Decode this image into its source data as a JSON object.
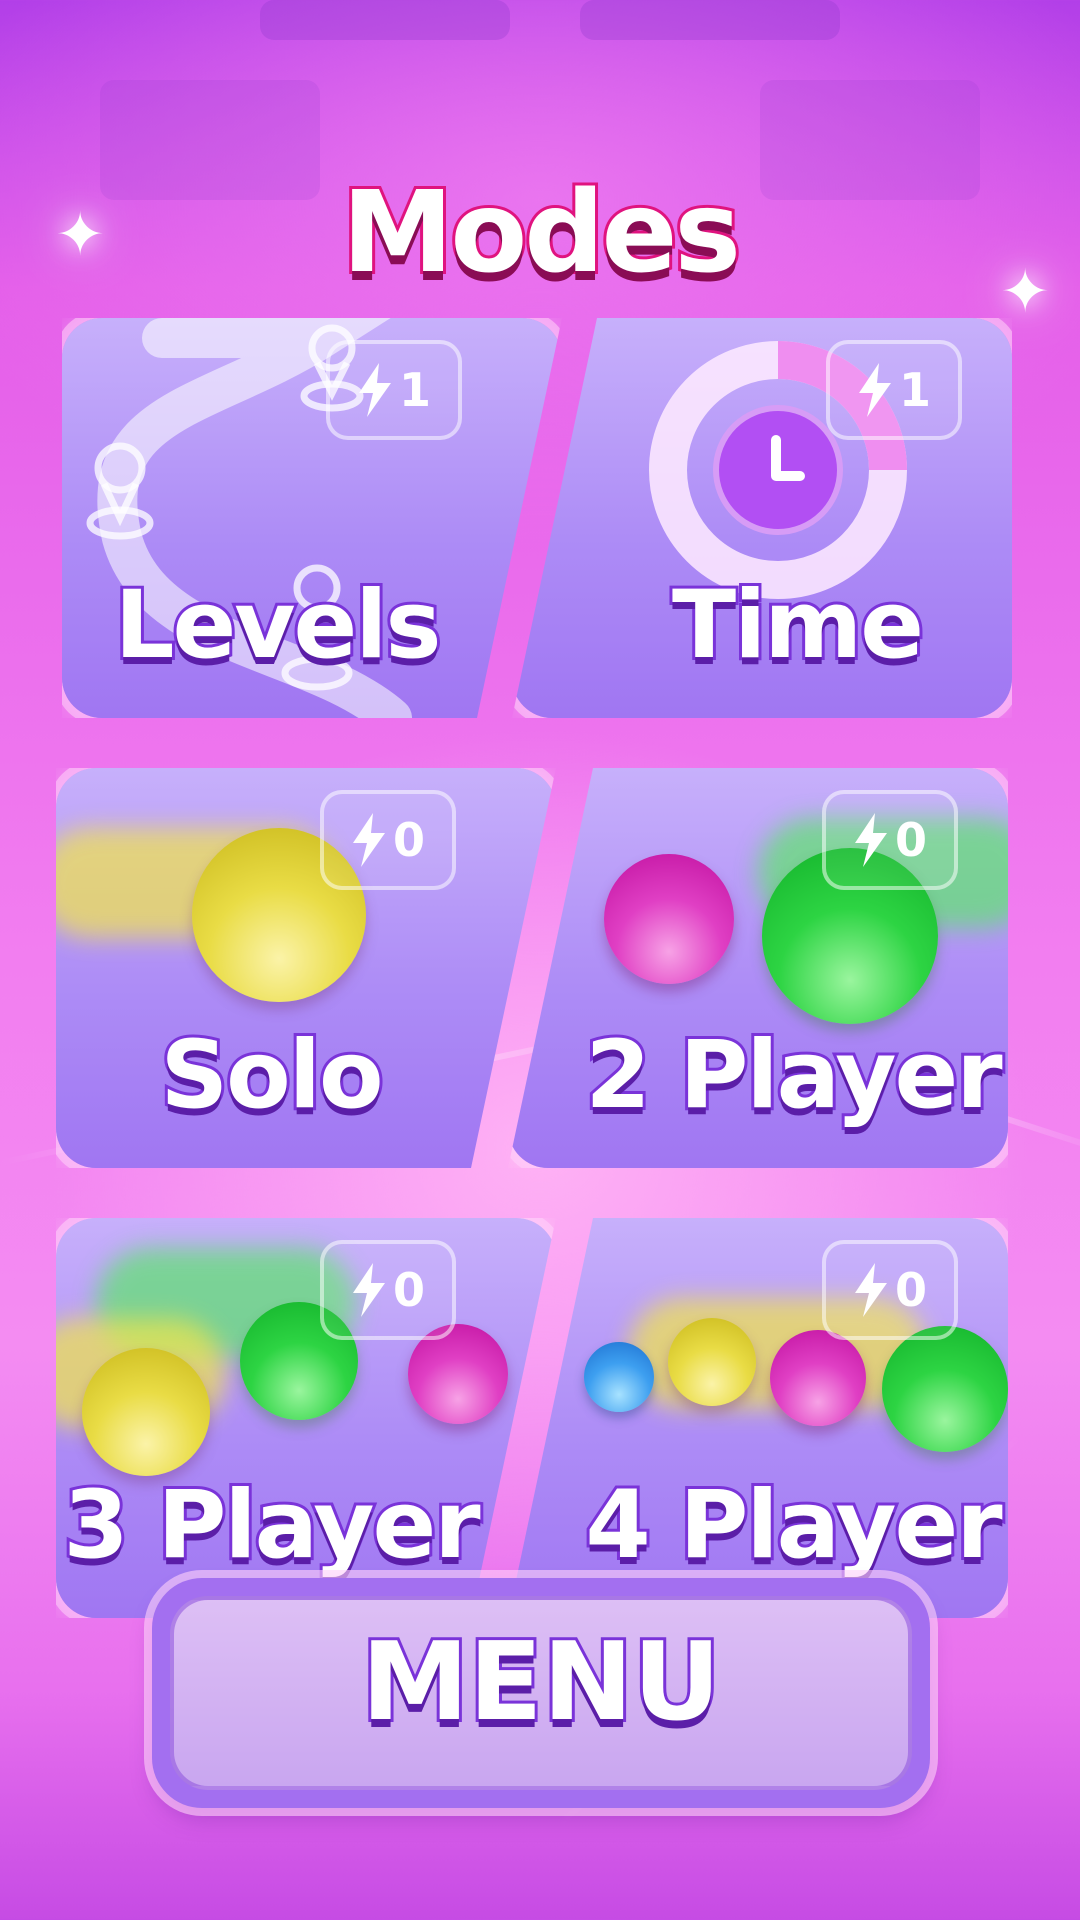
{
  "title": "Modes",
  "modes": [
    {
      "label": "Levels",
      "cost": "1",
      "icon": "map-path-icon"
    },
    {
      "label": "Time",
      "cost": "1",
      "icon": "timer-clock-icon"
    },
    {
      "label": "Solo",
      "cost": "0",
      "icon": "one-ball-icon"
    },
    {
      "label": "2 Player",
      "cost": "0",
      "icon": "two-balls-icon"
    },
    {
      "label": "3 Player",
      "cost": "0",
      "icon": "three-balls-icon"
    },
    {
      "label": "4 Player",
      "cost": "0",
      "icon": "four-balls-icon"
    }
  ],
  "menu_label": "MENU",
  "colors": {
    "card_top": "#c7b0fb",
    "card_bottom": "#a076f2",
    "label_outline": "#7a33d9",
    "title_outline": "#e0137f",
    "ball_yellow": "#e9dc45",
    "ball_green": "#2dd443",
    "ball_pink": "#e03fc4",
    "ball_blue": "#3d9ff0"
  }
}
